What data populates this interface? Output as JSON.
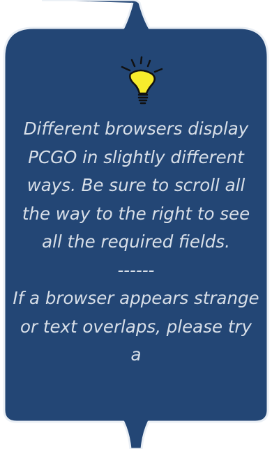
{
  "callout": {
    "colors": {
      "panel": "#234675",
      "outline": "#eaeff5",
      "text": "#d8dfe8",
      "bulb": "#f7ec2c"
    },
    "icon": "lightbulb-icon",
    "paragraph1": "Different browsers display PCGO in slightly different ways. Be sure to scroll all the way to the right to see all the required fields.",
    "divider": "------",
    "paragraph2": "If a browser appears strange or text overlaps, please try a"
  }
}
